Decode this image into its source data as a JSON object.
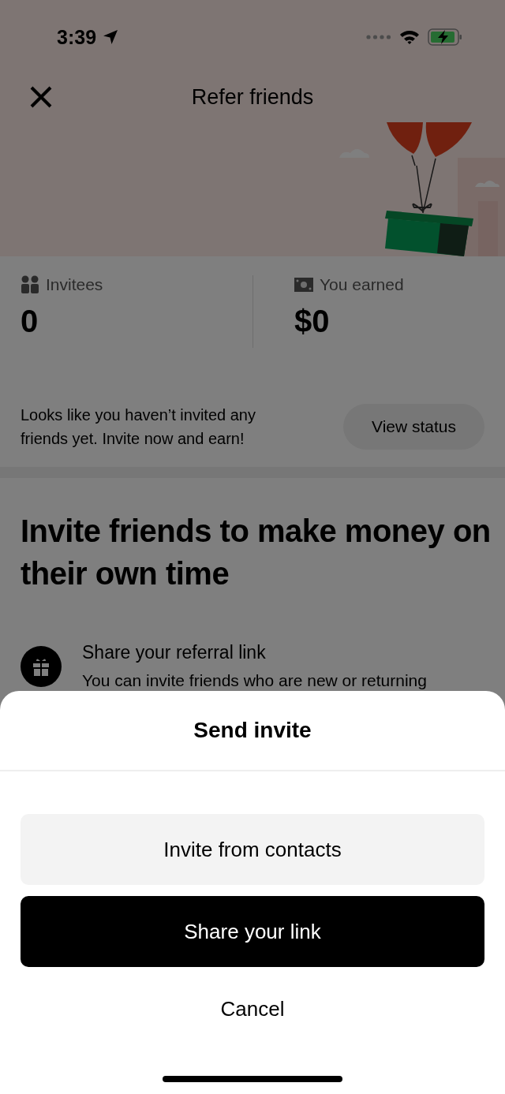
{
  "status_bar": {
    "time": "3:39"
  },
  "header": {
    "title": "Refer friends"
  },
  "stats": [
    {
      "kind": "people",
      "label": "Invitees",
      "value": "0"
    },
    {
      "kind": "cash",
      "label": "You earned",
      "value": "$0"
    }
  ],
  "status_message": {
    "text": "Looks like you haven’t invited any friends yet. Invite now and earn!",
    "button": "View status"
  },
  "headline": "Invite friends to make money on their own time",
  "steps": [
    {
      "title": "Share your referral link",
      "text": "You can invite friends who are new or returning"
    }
  ],
  "sheet": {
    "title": "Send invite",
    "buttons": [
      {
        "label": "Invite from contacts",
        "kind": "secondary"
      },
      {
        "label": "Share your link",
        "kind": "primary"
      },
      {
        "label": "Cancel",
        "kind": "plain"
      }
    ]
  }
}
